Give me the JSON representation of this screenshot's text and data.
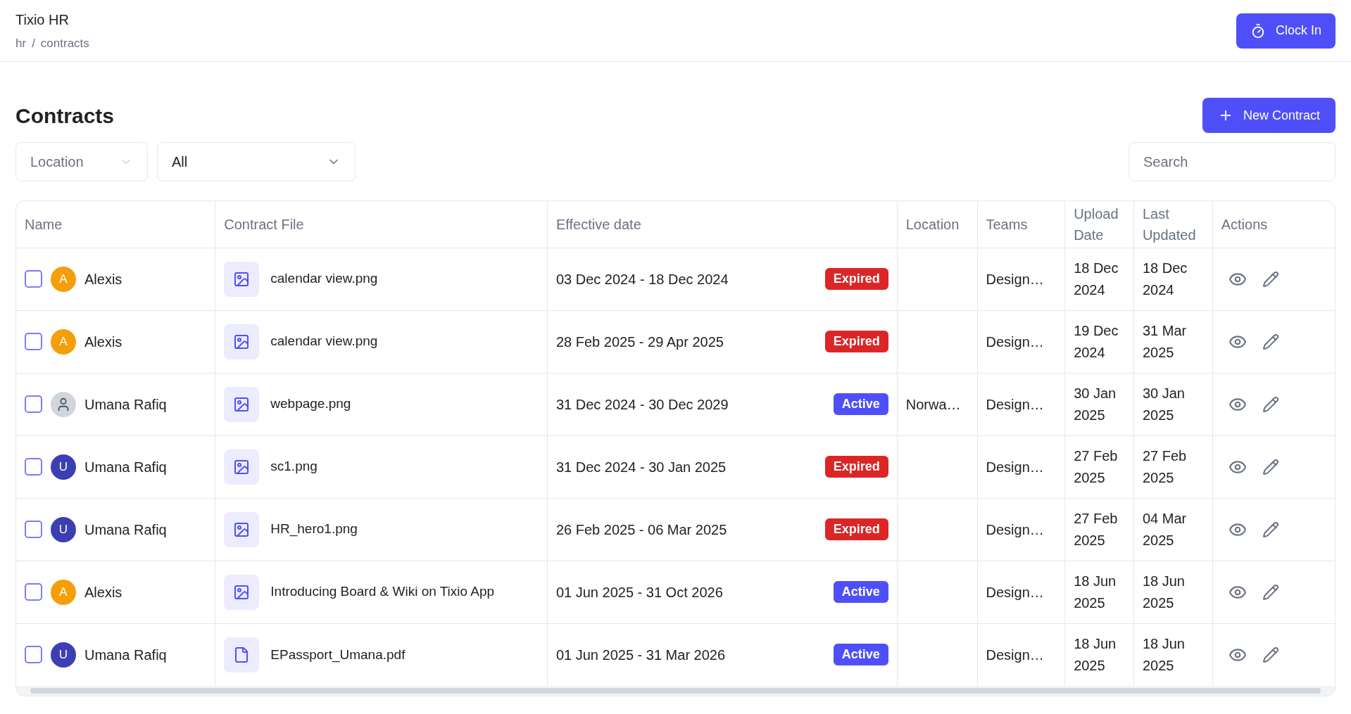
{
  "header": {
    "app_title": "Tixio HR",
    "breadcrumb": [
      "hr",
      "contracts"
    ],
    "breadcrumb_separator": "/",
    "clock_in_button": "Clock In"
  },
  "page_title": "Contracts",
  "new_contract_button": "New Contract",
  "filters": [
    {
      "placeholder": "Location"
    },
    {
      "value": "All"
    }
  ],
  "search": {
    "placeholder": "Search"
  },
  "table": {
    "columns": [
      "Name",
      "Contract File",
      "Effective date",
      "Location",
      "Teams",
      "Upload Date",
      "Last Updated",
      "Actions"
    ],
    "rows": [
      {
        "checked": false,
        "avatar": {
          "kind": "letter",
          "letter": "A",
          "color": "#f59e0b"
        },
        "name": "Alexis",
        "file": {
          "kind": "image",
          "name": "calendar view.png"
        },
        "effective": "03 Dec 2024 - 18 Dec 2024",
        "status": {
          "kind": "expired",
          "label": "Expired"
        },
        "teams": "Design…",
        "upload": [
          "18 Dec",
          "2024"
        ],
        "updated": [
          "18 Dec",
          "2024"
        ]
      },
      {
        "checked": false,
        "avatar": {
          "kind": "letter",
          "letter": "A",
          "color": "#f59e0b"
        },
        "name": "Alexis",
        "file": {
          "kind": "image",
          "name": "calendar view.png"
        },
        "effective": "28 Feb 2025 - 29 Apr 2025",
        "status": {
          "kind": "expired",
          "label": "Expired"
        },
        "teams": "Design…",
        "upload": [
          "19 Dec",
          "2024"
        ],
        "updated": [
          "31 Mar",
          "2025"
        ]
      },
      {
        "checked": false,
        "avatar": {
          "kind": "photo"
        },
        "name": "Umana Rafiq",
        "file": {
          "kind": "image",
          "name": "webpage.png"
        },
        "effective": "31 Dec 2024 - 30 Dec 2029",
        "status": {
          "kind": "active",
          "label": "Active"
        },
        "location": "Norwa…",
        "teams": "Design…",
        "upload": [
          "30 Jan",
          "2025"
        ],
        "updated": [
          "30 Jan",
          "2025"
        ]
      },
      {
        "checked": false,
        "avatar": {
          "kind": "letter",
          "letter": "U",
          "color": "#3c3fb3"
        },
        "name": "Umana Rafiq",
        "file": {
          "kind": "image",
          "name": "sc1.png"
        },
        "effective": "31 Dec 2024 - 30 Jan 2025",
        "status": {
          "kind": "expired",
          "label": "Expired"
        },
        "teams": "Design…",
        "upload": [
          "27 Feb",
          "2025"
        ],
        "updated": [
          "27 Feb",
          "2025"
        ]
      },
      {
        "checked": false,
        "avatar": {
          "kind": "letter",
          "letter": "U",
          "color": "#3c3fb3"
        },
        "name": "Umana Rafiq",
        "file": {
          "kind": "image",
          "name": "HR_hero1.png"
        },
        "effective": "26 Feb 2025 - 06 Mar 2025",
        "status": {
          "kind": "expired",
          "label": "Expired"
        },
        "teams": "Design…",
        "upload": [
          "27 Feb",
          "2025"
        ],
        "updated": [
          "04 Mar",
          "2025"
        ]
      },
      {
        "checked": false,
        "avatar": {
          "kind": "letter",
          "letter": "A",
          "color": "#f59e0b"
        },
        "name": "Alexis",
        "file": {
          "kind": "image",
          "name": "Introducing Board & Wiki on Tixio App"
        },
        "effective": "01 Jun 2025 - 31 Oct 2026",
        "status": {
          "kind": "active",
          "label": "Active"
        },
        "teams": "Design…",
        "upload": [
          "18 Jun",
          "2025"
        ],
        "updated": [
          "18 Jun",
          "2025"
        ]
      },
      {
        "checked": false,
        "avatar": {
          "kind": "letter",
          "letter": "U",
          "color": "#3c3fb3"
        },
        "name": "Umana Rafiq",
        "file": {
          "kind": "document",
          "name": "EPassport_Umana.pdf"
        },
        "effective": "01 Jun 2025 - 31 Mar 2026",
        "status": {
          "kind": "active",
          "label": "Active"
        },
        "teams": "Design…",
        "upload": [
          "18 Jun",
          "2025"
        ],
        "updated": [
          "18 Jun",
          "2025"
        ]
      }
    ]
  }
}
